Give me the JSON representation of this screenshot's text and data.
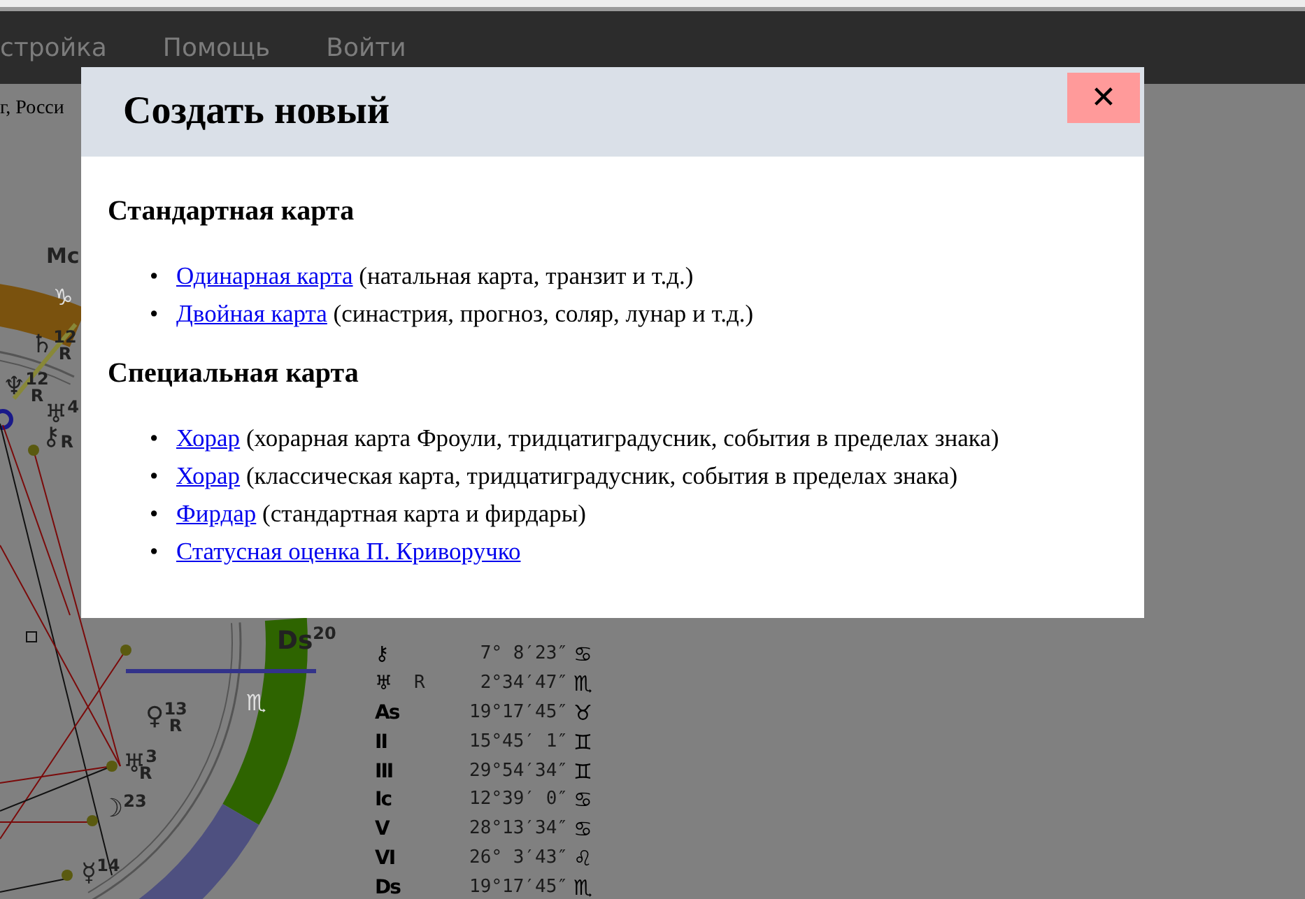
{
  "nav": {
    "items": [
      "стройка",
      "Помощь",
      "Войти"
    ]
  },
  "location_text": "г, Росси",
  "chart": {
    "labels": [
      {
        "glyph": "Mc"
      },
      {
        "glyph": "♑",
        "kind": "ring"
      },
      {
        "glyph": "♄",
        "degree": "12",
        "retro": "R"
      },
      {
        "glyph": "♆",
        "degree": "12",
        "retro": "R"
      },
      {
        "glyph": "♅",
        "degree": "4"
      },
      {
        "glyph": "⚷",
        "retro": "R"
      },
      {
        "glyph": "Ds",
        "degree": "20"
      },
      {
        "glyph": "♏",
        "kind": "ring"
      },
      {
        "glyph": "♀",
        "degree": "13",
        "retro": "R"
      },
      {
        "glyph": "♅",
        "degree": "3",
        "retro": "R"
      },
      {
        "glyph": "☽",
        "degree": "23"
      },
      {
        "glyph": "☿",
        "degree": "14"
      }
    ]
  },
  "positions": [
    {
      "glyph": "⚷",
      "position": "7° 8′23″",
      "sign": "♋"
    },
    {
      "glyph": "♅",
      "retro": "R",
      "position": "2°34′47″",
      "sign": "♏"
    },
    {
      "glyph": "As",
      "position": "19°17′45″",
      "sign": "♉"
    },
    {
      "glyph": "II",
      "position": "15°45′ 1″",
      "sign": "♊"
    },
    {
      "glyph": "III",
      "position": "29°54′34″",
      "sign": "♊"
    },
    {
      "glyph": "Ic",
      "position": "12°39′ 0″",
      "sign": "♋"
    },
    {
      "glyph": "V",
      "position": "28°13′34″",
      "sign": "♋"
    },
    {
      "glyph": "VI",
      "position": "26° 3′43″",
      "sign": "♌"
    },
    {
      "glyph": "Ds",
      "position": "19°17′45″",
      "sign": "♏"
    }
  ],
  "modal": {
    "title": "Создать новый",
    "close": "✕",
    "sections": [
      {
        "heading": "Стандартная карта",
        "marker": "•",
        "items": [
          {
            "link": "Одинарная карта",
            "note": "(натальная карта, транзит и т.д.)"
          },
          {
            "link": "Двойная карта",
            "note": "(синастрия, прогноз, соляр, лунар и т.д.)"
          }
        ]
      },
      {
        "heading": "Специальная карта",
        "marker": "•",
        "items": [
          {
            "link": "Хорар",
            "note": "(хорарная карта Фроули, тридцатиградусник, события в пределах знака)"
          },
          {
            "link": "Хорар",
            "note": "(классическая карта, тридцатиградусник, события в пределах знака)"
          },
          {
            "link": "Фирдар",
            "note": "(стандартная карта и фирдары)"
          },
          {
            "link": "Статусная оценка П. Криворучко"
          }
        ]
      }
    ]
  }
}
